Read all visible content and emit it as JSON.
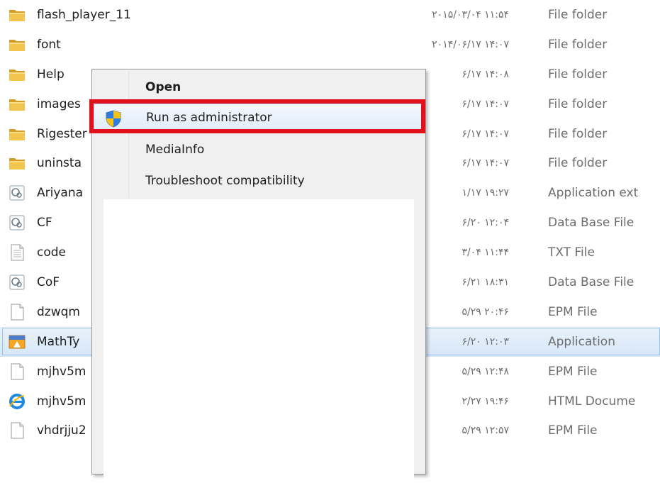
{
  "files": [
    {
      "name": "flash_player_11",
      "date": "۲۰۱۵/۰۳/۰۴ ۱۱:۵۴",
      "type": "File folder",
      "icon": "folder-icon"
    },
    {
      "name": "font",
      "date": "۲۰۱۴/۰۶/۱۷ ۱۴:۰۷",
      "type": "File folder",
      "icon": "folder-icon"
    },
    {
      "name": "Help",
      "date": "۶/۱۷ ۱۴:۰۸",
      "type": "File folder",
      "icon": "folder-icon"
    },
    {
      "name": "images",
      "date": "۶/۱۷ ۱۴:۰۷",
      "type": "File folder",
      "icon": "folder-icon"
    },
    {
      "name": "Rigester",
      "date": "۶/۱۷ ۱۴:۰۷",
      "type": "File folder",
      "icon": "folder-icon"
    },
    {
      "name": "uninsta",
      "date": "۶/۱۷ ۱۴:۰۷",
      "type": "File folder",
      "icon": "folder-icon"
    },
    {
      "name": "Ariyana",
      "date": "۱/۱۷ ۱۹:۲۷",
      "type": "Application ext",
      "icon": "extension-icon"
    },
    {
      "name": "CF",
      "date": "۶/۲۰ ۱۲:۰۴",
      "type": "Data Base File",
      "icon": "extension-icon"
    },
    {
      "name": "code",
      "date": "۳/۰۴ ۱۱:۴۴",
      "type": "TXT File",
      "icon": "text-file-icon"
    },
    {
      "name": "CoF",
      "date": "۶/۲۱ ۱۸:۳۱",
      "type": "Data Base File",
      "icon": "extension-icon"
    },
    {
      "name": "dzwqm",
      "date": "۵/۲۹ ۲۰:۴۶",
      "type": "EPM File",
      "icon": "blank-file-icon"
    },
    {
      "name": "MathTy",
      "date": "۶/۲۰ ۱۲:۰۳",
      "type": "Application",
      "icon": "mathtype-app-icon",
      "selected": true
    },
    {
      "name": "mjhv5m",
      "date": "۵/۲۹ ۱۲:۴۸",
      "type": "EPM File",
      "icon": "blank-file-icon"
    },
    {
      "name": "mjhv5m",
      "date": "۲/۲۷ ۱۹:۴۶",
      "type": "HTML Docume",
      "icon": "ie-html-icon"
    },
    {
      "name": "vhdrjju2",
      "date": "۵/۲۹ ۱۲:۵۷",
      "type": "EPM File",
      "icon": "blank-file-icon"
    }
  ],
  "context_menu": {
    "items": [
      {
        "label": "Open",
        "bold": true
      },
      {
        "label": "Run as administrator",
        "icon": "uac-shield-icon",
        "highlighted": true
      },
      {
        "label": "MediaInfo"
      },
      {
        "label": "Troubleshoot compatibility"
      }
    ]
  },
  "colors": {
    "highlight": "#e3101b",
    "selection": "#d6e7f8",
    "folder": "#e8b742"
  }
}
